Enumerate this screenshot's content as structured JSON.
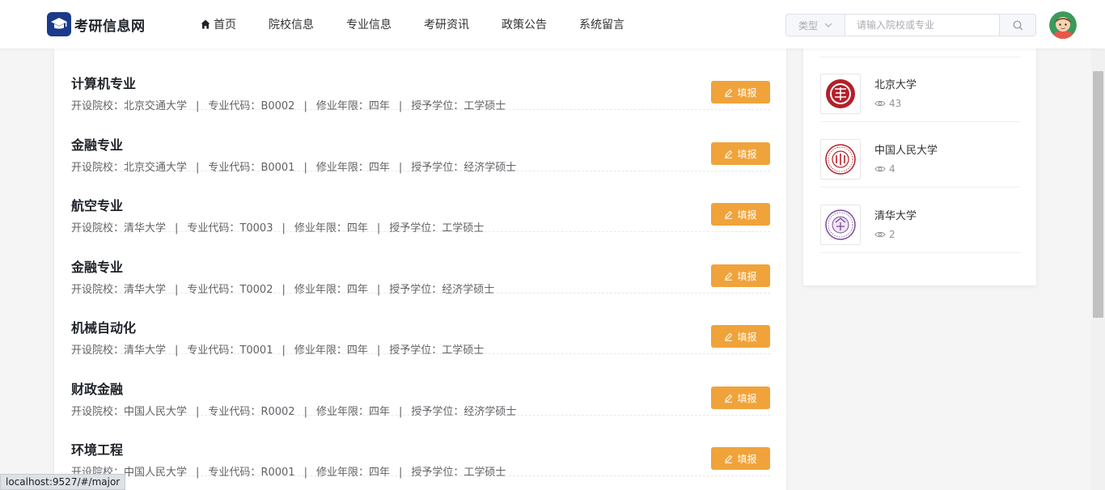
{
  "app": {
    "title": "考研信息网"
  },
  "nav": {
    "items": [
      {
        "label": "首页",
        "icon": "home-icon"
      },
      {
        "label": "院校信息"
      },
      {
        "label": "专业信息"
      },
      {
        "label": "考研资讯"
      },
      {
        "label": "政策公告"
      },
      {
        "label": "系统留言"
      }
    ]
  },
  "search": {
    "type_label": "类型",
    "placeholder": "请输入院校或专业"
  },
  "labels": {
    "school": "开设院校：",
    "code": "专业代码：",
    "years": "修业年限：",
    "degree": "授予学位：",
    "fill_button": "填报"
  },
  "majors": [
    {
      "name": "计算机专业",
      "school": "北京交通大学",
      "code": "B0002",
      "years": "四年",
      "degree": "工学硕士"
    },
    {
      "name": "金融专业",
      "school": "北京交通大学",
      "code": "B0001",
      "years": "四年",
      "degree": "经济学硕士"
    },
    {
      "name": "航空专业",
      "school": "清华大学",
      "code": "T0003",
      "years": "四年",
      "degree": "工学硕士"
    },
    {
      "name": "金融专业",
      "school": "清华大学",
      "code": "T0002",
      "years": "四年",
      "degree": "经济学硕士"
    },
    {
      "name": "机械自动化",
      "school": "清华大学",
      "code": "T0001",
      "years": "四年",
      "degree": "工学硕士"
    },
    {
      "name": "财政金融",
      "school": "中国人民大学",
      "code": "R0002",
      "years": "四年",
      "degree": "经济学硕士"
    },
    {
      "name": "环境工程",
      "school": "中国人民大学",
      "code": "R0001",
      "years": "四年",
      "degree": "工学硕士"
    }
  ],
  "schools": [
    {
      "name": "北京大学",
      "views": "43",
      "color": "#b3202a"
    },
    {
      "name": "中国人民大学",
      "views": "4",
      "color": "#b3202a"
    },
    {
      "name": "清华大学",
      "views": "2",
      "color": "#7b4a9a"
    }
  ],
  "status": {
    "url": "localhost:9527/#/major"
  },
  "colors": {
    "accent": "#f0a33a",
    "brand": "#1a3a8a"
  }
}
